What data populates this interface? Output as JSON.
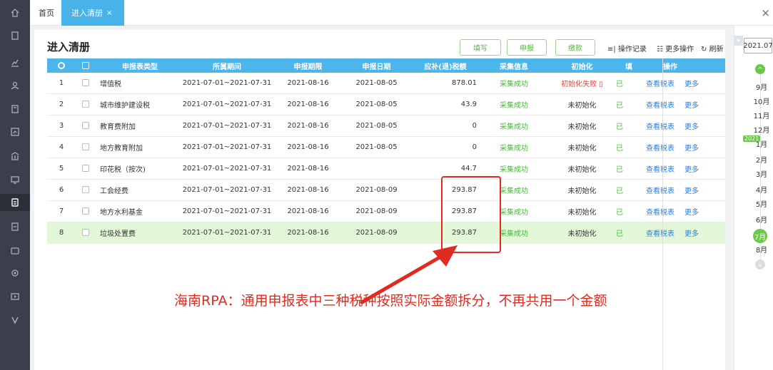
{
  "tabs": {
    "home": "首页",
    "active": "进入清册",
    "active_close": "×"
  },
  "window_close": "×",
  "page_title": "进入清册",
  "toolbar": {
    "fill": "填写",
    "declare": "申报",
    "pay": "缴款",
    "log": "操作记录",
    "more_ops": "更多操作",
    "refresh": "刷新"
  },
  "columns": [
    "申报表类型",
    "所属期间",
    "申报期限",
    "申报日期",
    "应补(退)税额",
    "采集信息",
    "初始化",
    "填",
    "操作"
  ],
  "rows": [
    {
      "no": "1",
      "type": "增值税",
      "period": "2021-07-01~2021-07-31",
      "deadline": "2021-08-16",
      "date": "2021-08-05",
      "amount": "878.01",
      "collect": "采集成功",
      "init": "初始化失败",
      "fill": "已",
      "view": "查看税表",
      "more": "更多"
    },
    {
      "no": "2",
      "type": "城市维护建设税",
      "period": "2021-07-01~2021-07-31",
      "deadline": "2021-08-16",
      "date": "2021-08-05",
      "amount": "43.9",
      "collect": "采集成功",
      "init": "未初始化",
      "fill": "已",
      "view": "查看税表",
      "more": "更多"
    },
    {
      "no": "3",
      "type": "教育费附加",
      "period": "2021-07-01~2021-07-31",
      "deadline": "2021-08-16",
      "date": "2021-08-05",
      "amount": "0",
      "collect": "采集成功",
      "init": "未初始化",
      "fill": "已",
      "view": "查看税表",
      "more": "更多"
    },
    {
      "no": "4",
      "type": "地方教育附加",
      "period": "2021-07-01~2021-07-31",
      "deadline": "2021-08-16",
      "date": "2021-08-05",
      "amount": "0",
      "collect": "采集成功",
      "init": "未初始化",
      "fill": "已",
      "view": "查看税表",
      "more": "更多"
    },
    {
      "no": "5",
      "type": "印花税（按次)",
      "period": "2021-07-01~2021-07-31",
      "deadline": "2021-08-16",
      "date": "",
      "amount": "44.7",
      "collect": "采集成功",
      "init": "未初始化",
      "fill": "已",
      "view": "查看税表",
      "more": "更多"
    },
    {
      "no": "6",
      "type": "工会经费",
      "period": "2021-07-01~2021-07-31",
      "deadline": "2021-08-16",
      "date": "2021-08-09",
      "amount": "293.87",
      "collect": "采集成功",
      "init": "未初始化",
      "fill": "已",
      "view": "查看税表",
      "more": "更多"
    },
    {
      "no": "7",
      "type": "地方水利基金",
      "period": "2021-07-01~2021-07-31",
      "deadline": "2021-08-16",
      "date": "2021-08-09",
      "amount": "293.87",
      "collect": "采集成功",
      "init": "未初始化",
      "fill": "已",
      "view": "查看税表",
      "more": "更多"
    },
    {
      "no": "8",
      "type": "垃圾处置费",
      "period": "2021-07-01~2021-07-31",
      "deadline": "2021-08-16",
      "date": "2021-08-09",
      "amount": "293.87",
      "collect": "采集成功",
      "init": "未初始化",
      "fill": "已",
      "view": "查看税表",
      "more": "更多"
    }
  ],
  "annotation": "海南RPA：通用申报表中三种税种按照实际金额拆分，不再共用一个金额",
  "timeline": {
    "year_select": "2021.07",
    "year_tag": "2021",
    "months": [
      "9月",
      "10月",
      "11月",
      "12月",
      "1月",
      "2月",
      "3月",
      "4月",
      "5月",
      "6月",
      "7月",
      "8月"
    ],
    "current": "7月"
  },
  "colors": {
    "accent": "#4cb5ec",
    "success": "#4aba3c",
    "error": "#e4453a",
    "highlight_row": "#e2f7d8",
    "sidebar": "#3a3f4b"
  }
}
